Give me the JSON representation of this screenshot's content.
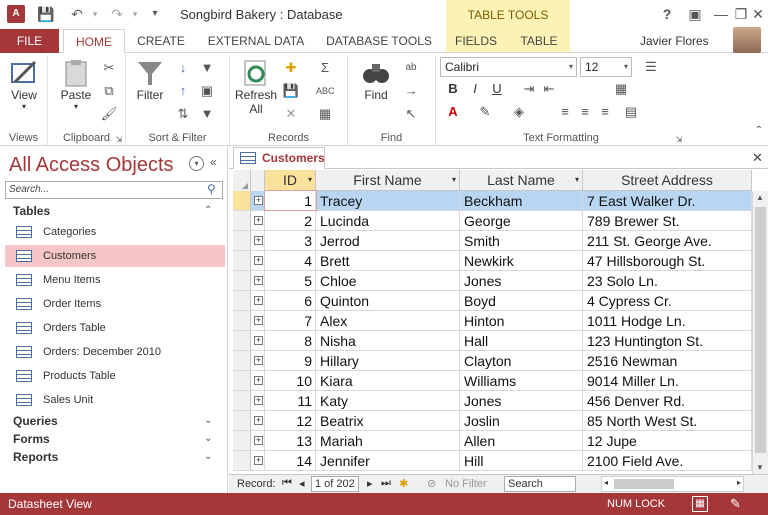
{
  "app": {
    "icon_label": "A",
    "window_title": "Songbird Bakery : Database",
    "context_group": "TABLE TOOLS",
    "user_name": "Javier Flores",
    "help": "?",
    "minimize": "—",
    "restore": "❐",
    "close": "✕"
  },
  "tabs": {
    "file": "FILE",
    "home": "HOME",
    "create": "CREATE",
    "external": "EXTERNAL DATA",
    "dbtools": "DATABASE TOOLS",
    "fields": "FIELDS",
    "table": "TABLE"
  },
  "ribbon": {
    "views": {
      "label": "Views",
      "view_btn": "View"
    },
    "clipboard": {
      "label": "Clipboard",
      "paste_btn": "Paste"
    },
    "sortfilter": {
      "label": "Sort & Filter",
      "filter_btn": "Filter"
    },
    "records": {
      "label": "Records",
      "refresh_btn": "Refresh",
      "refresh_sub": "All"
    },
    "find": {
      "label": "Find",
      "find_btn": "Find"
    },
    "text": {
      "label": "Text Formatting",
      "font": "Calibri",
      "size": "12"
    }
  },
  "nav": {
    "title": "All Access Objects",
    "search_placeholder": "Search...",
    "sections": [
      "Tables",
      "Queries",
      "Forms",
      "Reports"
    ],
    "tables": [
      "Categories",
      "Customers",
      "Menu Items",
      "Order Items",
      "Orders Table",
      "Orders: December 2010",
      "Products Table",
      "Sales Unit"
    ],
    "selected": "Customers"
  },
  "document": {
    "tab_label": "Customers",
    "columns": [
      "ID",
      "First Name",
      "Last Name",
      "Street Address"
    ],
    "rows": [
      [
        "1",
        "Tracey",
        "Beckham",
        "7 East Walker Dr."
      ],
      [
        "2",
        "Lucinda",
        "George",
        "789 Brewer St."
      ],
      [
        "3",
        "Jerrod",
        "Smith",
        "211 St. George Ave."
      ],
      [
        "4",
        "Brett",
        "Newkirk",
        "47 Hillsborough St."
      ],
      [
        "5",
        "Chloe",
        "Jones",
        "23 Solo Ln."
      ],
      [
        "6",
        "Quinton",
        "Boyd",
        "4 Cypress Cr."
      ],
      [
        "7",
        "Alex",
        "Hinton",
        "1011 Hodge Ln."
      ],
      [
        "8",
        "Nisha",
        "Hall",
        "123 Huntington St."
      ],
      [
        "9",
        "Hillary",
        "Clayton",
        "2516 Newman"
      ],
      [
        "10",
        "Kiara",
        "Williams",
        "9014 Miller Ln."
      ],
      [
        "11",
        "Katy",
        "Jones",
        "456 Denver Rd."
      ],
      [
        "12",
        "Beatrix",
        "Joslin",
        "85 North West St."
      ],
      [
        "13",
        "Mariah",
        "Allen",
        "12 Jupe"
      ],
      [
        "14",
        "Jennifer",
        "Hill",
        "2100 Field Ave."
      ]
    ]
  },
  "record_nav": {
    "label": "Record:",
    "position": "1 of 202",
    "no_filter": "No Filter",
    "search": "Search"
  },
  "status": {
    "left": "Datasheet View",
    "num_lock": "NUM LOCK"
  },
  "colors": {
    "accent": "#a4373a",
    "context": "#fcf2b6",
    "selected_row": "#b8d6f2",
    "nav_selected": "#f6c5c5"
  }
}
